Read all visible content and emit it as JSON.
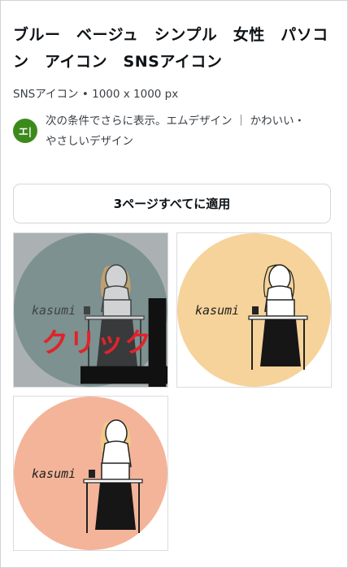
{
  "template": {
    "title": "ブルー　ベージュ　シンプル　女性　パソコン　アイコン　SNSアイコン",
    "meta": "SNSアイコン • 1000 x 1000 px"
  },
  "author": {
    "avatar_text": "エ|",
    "text": "次の条件でさらに表示。エムデザイン ｜ かわいい・やさしいデザイン"
  },
  "actions": {
    "apply_all_label": "3ページすべてに適用"
  },
  "pages": [
    {
      "circle_color": "#7f9b99",
      "label": "kasumi",
      "hovered": true,
      "hover_text": "クリック"
    },
    {
      "circle_color": "#f6d39a",
      "label": "kasumi",
      "hovered": false
    },
    {
      "circle_color": "#f4b499",
      "label": "kasumi",
      "hovered": false
    }
  ]
}
